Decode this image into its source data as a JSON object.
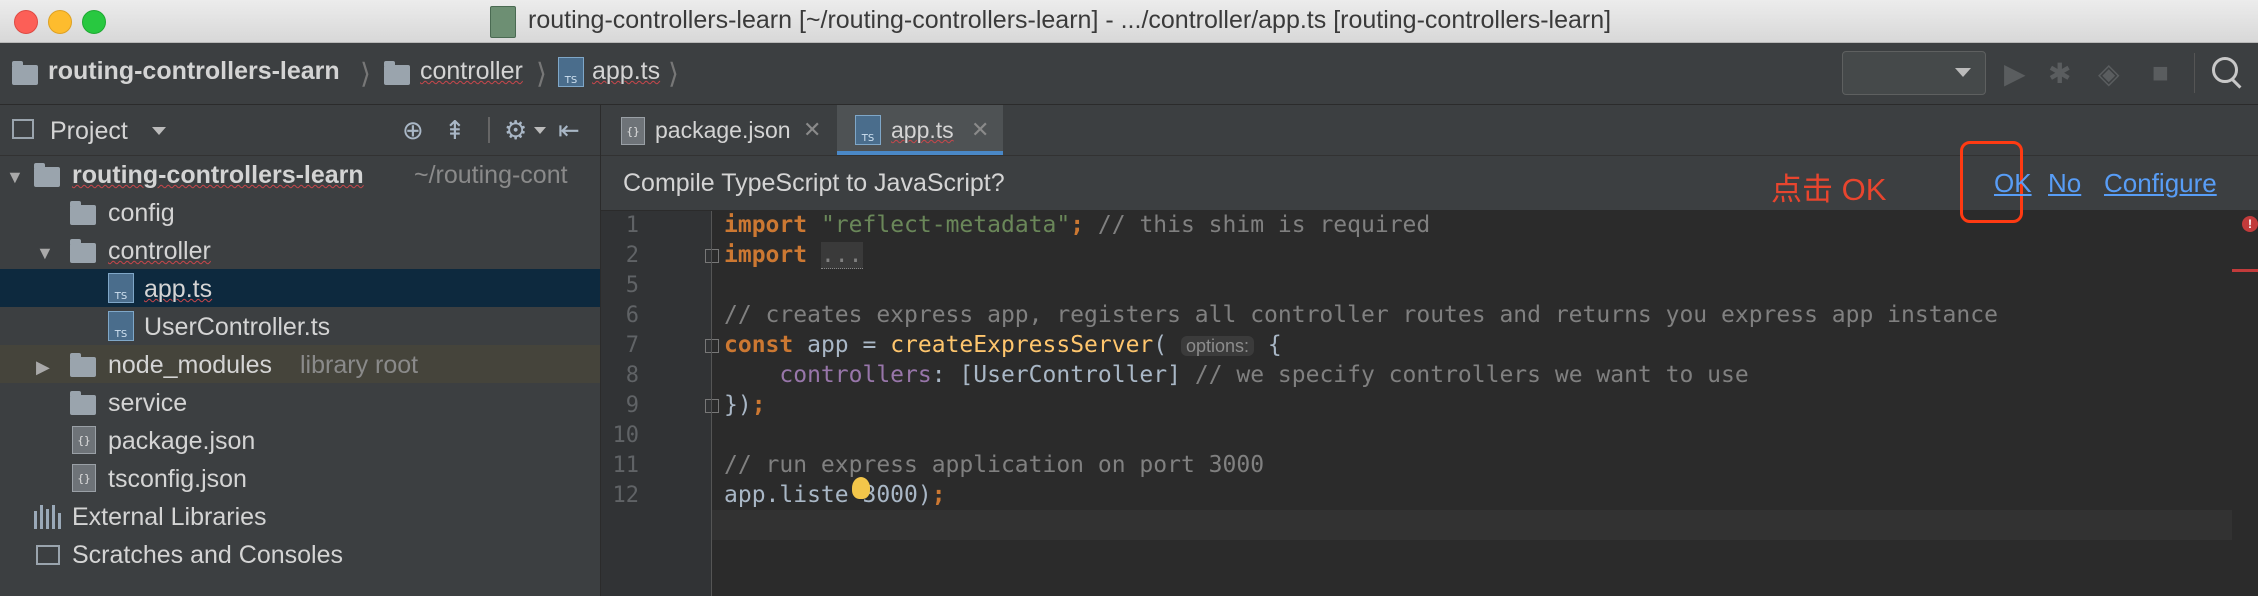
{
  "window": {
    "title": "routing-controllers-learn [~/routing-controllers-learn] - .../controller/app.ts [routing-controllers-learn]"
  },
  "breadcrumb": {
    "project": "routing-controllers-learn",
    "folder": "controller",
    "file": "app.ts",
    "ts_icon": "TS"
  },
  "project_panel": {
    "title": "Project",
    "tree": {
      "root": {
        "label": "routing-controllers-learn",
        "path": "~/routing-cont"
      },
      "items": [
        {
          "label": "config"
        },
        {
          "label": "controller"
        },
        {
          "label": "app.ts"
        },
        {
          "label": "UserController.ts"
        },
        {
          "label": "node_modules",
          "suffix": "library root"
        },
        {
          "label": "service"
        },
        {
          "label": "package.json"
        },
        {
          "label": "tsconfig.json"
        }
      ],
      "external_libraries": "External Libraries",
      "scratches": "Scratches and Consoles"
    }
  },
  "tabs": [
    {
      "label": "package.json",
      "active": false
    },
    {
      "label": "app.ts",
      "active": true
    }
  ],
  "banner": {
    "message": "Compile TypeScript to JavaScript?",
    "annotation": "点击 OK",
    "ok": "OK",
    "no": "No",
    "configure": "Configure"
  },
  "editor": {
    "line_numbers": [
      "1",
      "2",
      "5",
      "6",
      "7",
      "8",
      "9",
      "10",
      "11",
      "12"
    ],
    "line1": {
      "kw": "import",
      "str": "\"reflect-metadata\"",
      "punct": ";",
      "cmt": " // this shim is required"
    },
    "line2": {
      "kw": "import",
      "folded": "..."
    },
    "line5": {
      "cmt": "// creates express app, registers all controller routes and returns you express app instance"
    },
    "line6": {
      "kw": "const",
      "text1": " app = ",
      "fn": "createExpressServer",
      "paren": "(",
      "hint": "options:",
      "brace": " {"
    },
    "line7": {
      "prop": "controllers",
      "text": ": [UserController]",
      "cmt": " // we specify controllers we want to use"
    },
    "line8": {
      "text": "})",
      "punct": ";"
    },
    "line10": {
      "cmt": "// run express application on port 3000"
    },
    "line11": {
      "text1": "app.liste",
      "text2": "3000)",
      "punct": ";"
    }
  },
  "colors": {
    "accent": "#4a88c7",
    "annotation_red": "#ff3a12",
    "link": "#589df6"
  }
}
